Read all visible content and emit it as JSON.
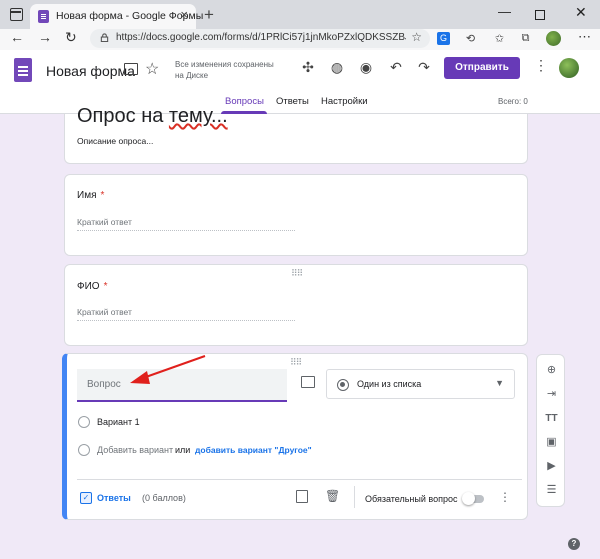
{
  "browser": {
    "tab_title": "Новая форма - Google Формы",
    "tab_close": "×",
    "new_tab": "+",
    "url": "https://docs.google.com/forms/d/1PRlCi57j1jnMkoPZxlQDKSSZBJEQRBTO...",
    "back": "←",
    "forward": "→",
    "reload": "↻",
    "min": "—",
    "close": "✕",
    "menu": "⋯"
  },
  "header": {
    "form_title": "Новая форма",
    "save_status_1": "Все изменения сохранены",
    "save_status_2": "на Диске",
    "send_label": "Отправить",
    "more": "⋮"
  },
  "tabs": [
    {
      "label": "Вопросы",
      "active": true
    },
    {
      "label": "Ответы",
      "active": false
    },
    {
      "label": "Настройки",
      "active": false
    }
  ],
  "score": "Всего: 0",
  "survey": {
    "title_prefix": "Опрос на ",
    "title_underlined": "тему...",
    "description": "Описание опроса..."
  },
  "questions": [
    {
      "label": "Имя",
      "required_mark": "*",
      "placeholder": "Краткий ответ"
    },
    {
      "label": "ФИО",
      "required_mark": "*",
      "placeholder": "Краткий ответ"
    }
  ],
  "active_question": {
    "placeholder": "Вопрос",
    "type": "Один из списка",
    "option1": "Вариант 1",
    "add_option": "Добавить вариант",
    "or": "или",
    "add_other": "добавить вариант \"Другое\"",
    "answers_label": "Ответы",
    "points": "(0 баллов)",
    "required_label": "Обязательный вопрос",
    "more": "⋮"
  },
  "drag_handle": "⠿⠿",
  "colors": {
    "accent": "#673ab7",
    "blue": "#4285f4",
    "arrow": "#e0201c",
    "background": "#f0e9f7"
  },
  "side_tools": [
    "add-question-icon",
    "import-icon",
    "title-icon",
    "image-icon",
    "video-icon",
    "section-icon"
  ],
  "help": "?"
}
